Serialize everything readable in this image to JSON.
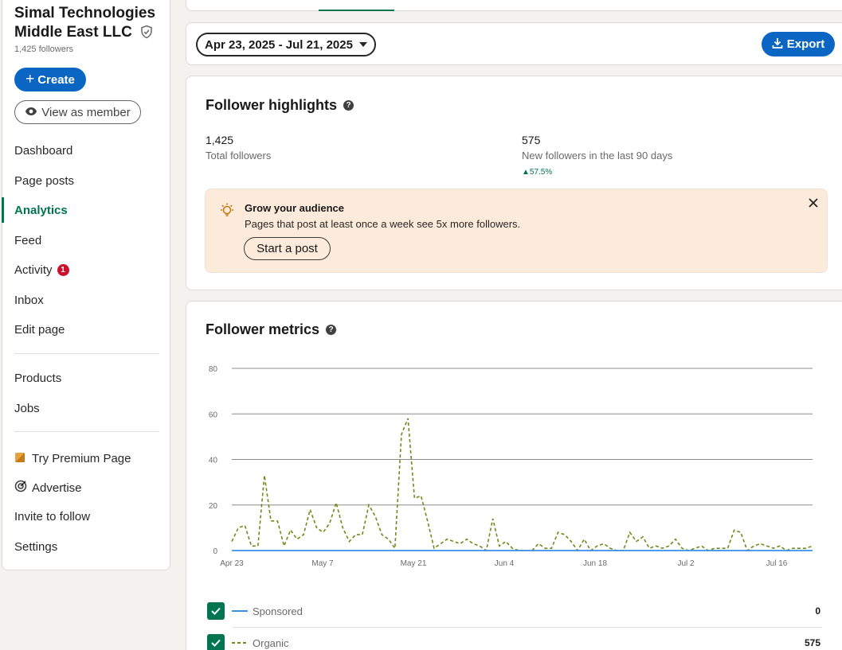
{
  "sidebar": {
    "org_name": "Simal Technologies Middle East LLC",
    "org_followers": "1,425 followers",
    "create_label": "Create",
    "view_as_member_label": "View as member",
    "nav": [
      {
        "label": "Dashboard"
      },
      {
        "label": "Page posts"
      },
      {
        "label": "Analytics",
        "active": true
      },
      {
        "label": "Feed"
      },
      {
        "label": "Activity",
        "badge": "1"
      },
      {
        "label": "Inbox"
      },
      {
        "label": "Edit page"
      }
    ],
    "secondary": [
      {
        "label": "Products"
      },
      {
        "label": "Jobs"
      }
    ],
    "tertiary": [
      {
        "label": "Try Premium Page",
        "icon": "premium-icon"
      },
      {
        "label": "Advertise",
        "icon": "target-icon"
      },
      {
        "label": "Invite to follow"
      },
      {
        "label": "Settings"
      }
    ]
  },
  "filter": {
    "date_range": "Apr 23, 2025 - Jul 21, 2025",
    "export_label": "Export"
  },
  "highlights": {
    "title": "Follower highlights",
    "total_value": "1,425",
    "total_label": "Total followers",
    "new_value": "575",
    "new_label": "New followers in the last 90 days",
    "new_change": "57.5%",
    "grow": {
      "title": "Grow your audience",
      "text": "Pages that post at least once a week see 5x more followers.",
      "button": "Start a post"
    }
  },
  "metrics": {
    "title": "Follower metrics",
    "legend": [
      {
        "label": "Sponsored",
        "value": "0"
      },
      {
        "label": "Organic",
        "value": "575"
      }
    ]
  },
  "colors": {
    "brand_blue": "#0a66c2",
    "active_green": "#01754f",
    "organic_line": "#6b8c1a",
    "sponsored_line": "#378fe9"
  },
  "chart_data": {
    "type": "line",
    "x_ticks": [
      "Apr 23",
      "May 7",
      "May 21",
      "Jun 4",
      "Jun 18",
      "Jul 2",
      "Jul 16"
    ],
    "x_start": "Apr 23, 2025",
    "x_end": "Jul 21, 2025",
    "y_ticks": [
      0,
      20,
      40,
      60,
      80
    ],
    "ylim": [
      0,
      80
    ],
    "grid": true,
    "series": [
      {
        "name": "Sponsored",
        "style": "solid",
        "values": [
          0,
          0,
          0,
          0,
          0,
          0,
          0,
          0,
          0,
          0,
          0,
          0,
          0,
          0,
          0,
          0,
          0,
          0,
          0,
          0,
          0,
          0,
          0,
          0,
          0,
          0,
          0,
          0,
          0,
          0,
          0,
          0,
          0,
          0,
          0,
          0,
          0,
          0,
          0,
          0,
          0,
          0,
          0,
          0,
          0,
          0,
          0,
          0,
          0,
          0,
          0,
          0,
          0,
          0,
          0,
          0,
          0,
          0,
          0,
          0,
          0,
          0,
          0,
          0,
          0,
          0,
          0,
          0,
          0,
          0,
          0,
          0,
          0,
          0,
          0,
          0,
          0,
          0,
          0,
          0,
          0,
          0,
          0,
          0,
          0,
          0,
          0,
          0,
          0,
          0
        ]
      },
      {
        "name": "Organic",
        "style": "dashed",
        "values": [
          4,
          10,
          11,
          2,
          2,
          33,
          13,
          13,
          2,
          9,
          5,
          7,
          18,
          10,
          8,
          12,
          21,
          10,
          4,
          7,
          7,
          20,
          15,
          7,
          5,
          1,
          51,
          58,
          23,
          24,
          13,
          1,
          3,
          5,
          4,
          3,
          5,
          3,
          2,
          0,
          14,
          2,
          4,
          1,
          0,
          0,
          0,
          3,
          1,
          1,
          8,
          7,
          4,
          0,
          5,
          0,
          2,
          3,
          1,
          0,
          0,
          8,
          4,
          6,
          1,
          2,
          1,
          2,
          5,
          1,
          0,
          1,
          2,
          0,
          1,
          1,
          1,
          9,
          8,
          0,
          2,
          3,
          2,
          1,
          2,
          0,
          1,
          1,
          1,
          2
        ]
      }
    ]
  }
}
